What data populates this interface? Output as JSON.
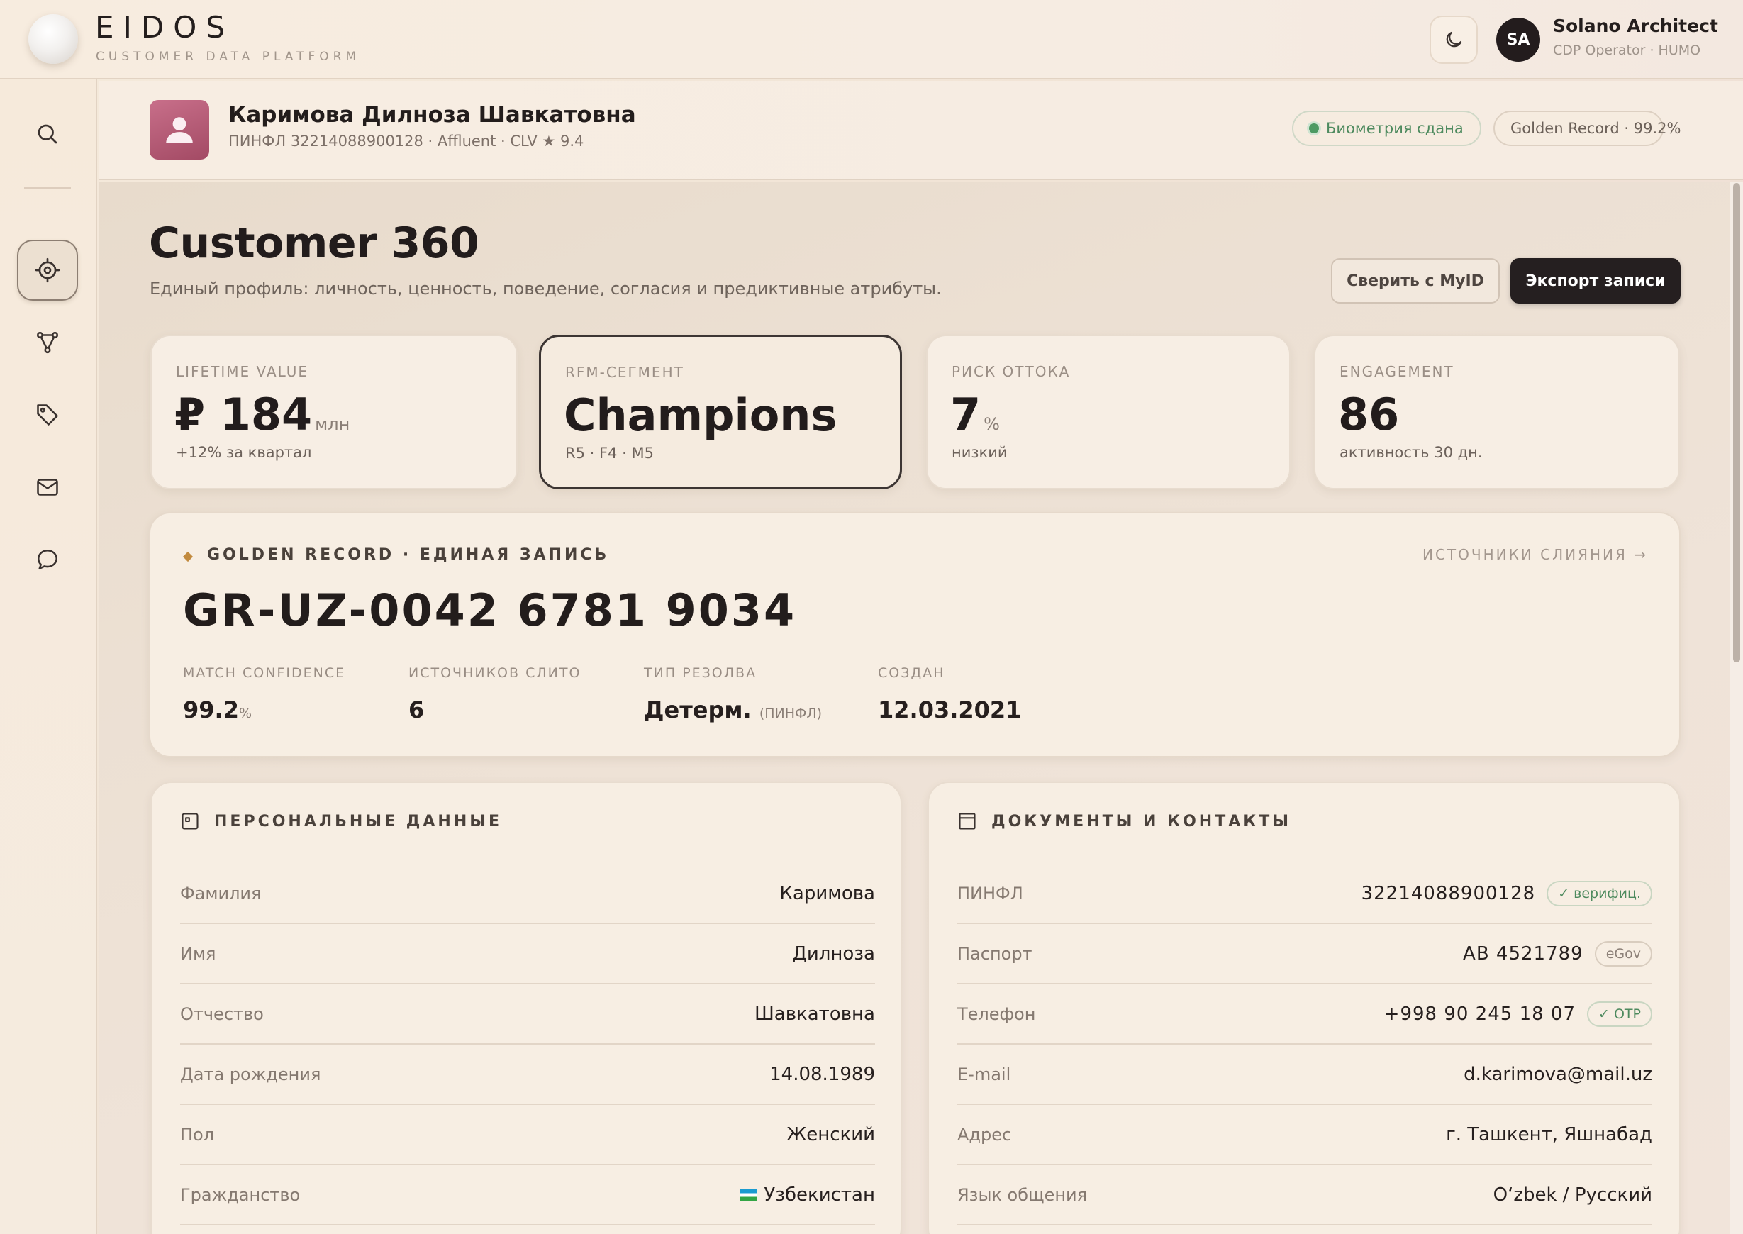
{
  "brand": {
    "name": "EIDOS",
    "subtitle": "CUSTOMER DATA PLATFORM"
  },
  "user": {
    "initials": "SA",
    "name": "Solano Architect",
    "role": "CDP Operator · HUMO"
  },
  "icons": {
    "theme": "moon-icon",
    "sidebar": [
      "search-icon",
      "target-icon",
      "graph-icon",
      "tag-icon",
      "mail-icon",
      "chat-icon"
    ],
    "customer": "user-icon"
  },
  "colors": {
    "accent_dark": "#251f20",
    "verified_green": "#4d8a5e",
    "avatar_rose": "#b45a76",
    "gold": "#c28a3e"
  },
  "customer": {
    "name": "Каримова Дилноза Шавкатовна",
    "meta": "ПИНФЛ 32214088900128 · Affluent · CLV ★ 9.4",
    "badge_biometric": "Биометрия сдана",
    "badge_golden": "Golden Record · 99.2%"
  },
  "page": {
    "title": "Customer 360",
    "subtitle": "Единый профиль: личность, ценность, поведение, согласия и предиктивные атрибуты.",
    "btn_verify": "Сверить с MyID",
    "btn_export": "Экспорт записи"
  },
  "kpis": [
    {
      "label": "LIFETIME VALUE",
      "value": "₽ 184",
      "unit": "млн",
      "note": "+12% за квартал"
    },
    {
      "label": "RFM-СЕГМЕНТ",
      "value": "Champions",
      "unit": "",
      "note": "R5 · F4 · M5"
    },
    {
      "label": "РИСК ОТТОКА",
      "value": "7",
      "unit": "%",
      "note": "низкий"
    },
    {
      "label": "ENGAGEMENT",
      "value": "86",
      "unit": "",
      "note": "активность 30 дн."
    }
  ],
  "golden_record": {
    "title": "GOLDEN RECORD · ЕДИНАЯ ЗАПИСЬ",
    "link": "ИСТОЧНИКИ СЛИЯНИЯ →",
    "id": "GR-UZ-0042 6781 9034",
    "stats": [
      {
        "label": "MATCH CONFIDENCE",
        "value": "99.2",
        "suffix": "%"
      },
      {
        "label": "ИСТОЧНИКОВ СЛИТО",
        "value": "6",
        "suffix": ""
      },
      {
        "label": "ТИП РЕЗОЛВА",
        "value": "Детерм.",
        "suffix": "(ПИНФЛ)"
      },
      {
        "label": "СОЗДАН",
        "value": "12.03.2021",
        "suffix": ""
      }
    ]
  },
  "personal": {
    "title": "ПЕРСОНАЛЬНЫЕ ДАННЫЕ",
    "rows": [
      {
        "label": "Фамилия",
        "value": "Каримова"
      },
      {
        "label": "Имя",
        "value": "Дилноза"
      },
      {
        "label": "Отчество",
        "value": "Шавкатовна"
      },
      {
        "label": "Дата рождения",
        "value": "14.08.1989"
      },
      {
        "label": "Пол",
        "value": "Женский"
      },
      {
        "label": "Гражданство",
        "value": "Узбекистан"
      }
    ]
  },
  "documents": {
    "title": "ДОКУМЕНТЫ И КОНТАКТЫ",
    "rows": [
      {
        "label": "ПИНФЛ",
        "value": "32214088900128",
        "badge": "✓ верифиц."
      },
      {
        "label": "Паспорт",
        "value": "AB 4521789",
        "badge": "eGov"
      },
      {
        "label": "Телефон",
        "value": "+998 90 245 18 07",
        "badge": "✓ OTP"
      },
      {
        "label": "E-mail",
        "value": "d.karimova@mail.uz",
        "badge": ""
      },
      {
        "label": "Адрес",
        "value": "г. Ташкент, Яшнабад",
        "badge": ""
      },
      {
        "label": "Язык общения",
        "value": "O‘zbek / Русский",
        "badge": ""
      }
    ]
  }
}
